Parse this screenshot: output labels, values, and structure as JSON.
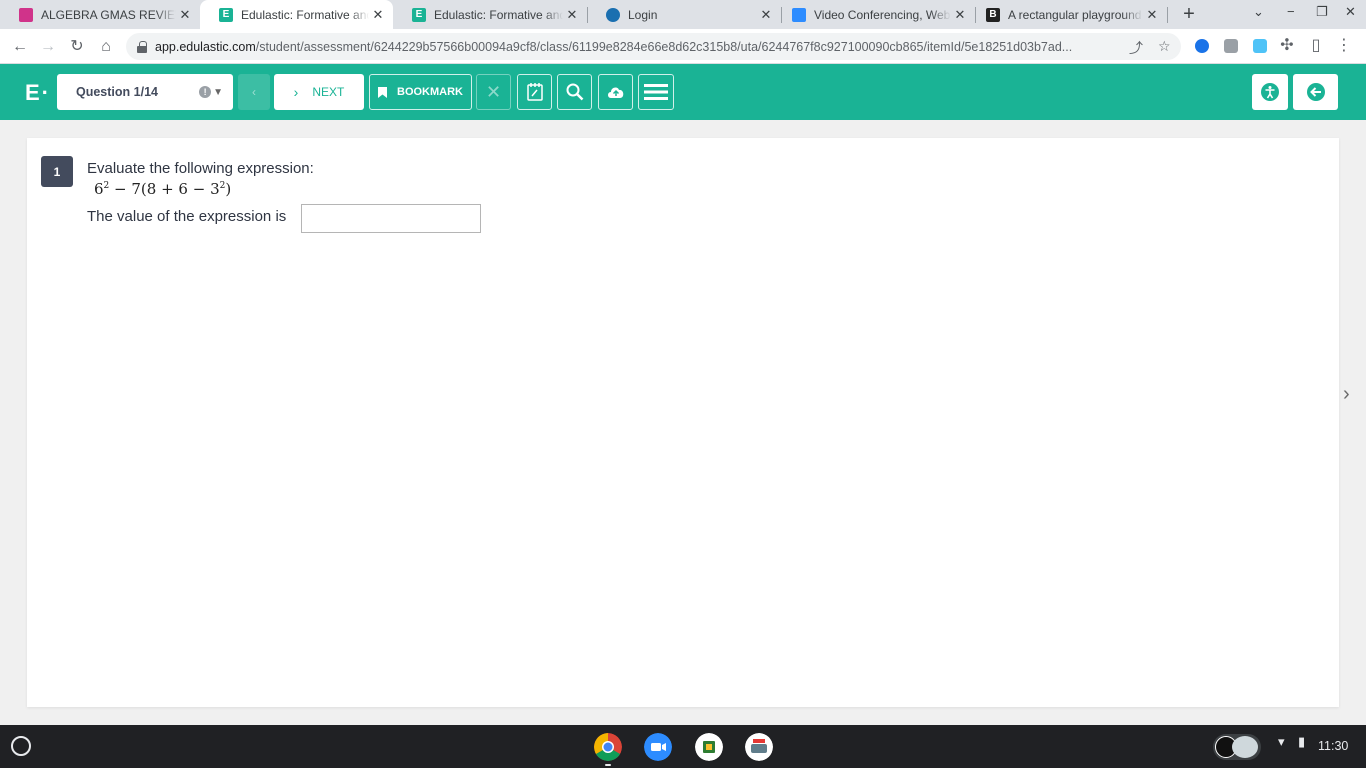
{
  "browser": {
    "tabs": [
      {
        "title": "ALGEBRA GMAS REVIEW",
        "favicon_color": "#d0338a",
        "favicon_glyph": "",
        "active": false
      },
      {
        "title": "Edulastic: Formative and Summative Assessments",
        "favicon_color": "#1ab395",
        "favicon_glyph": "E",
        "active": true
      },
      {
        "title": "Edulastic: Formative and Summative Assessments",
        "favicon_color": "#1ab395",
        "favicon_glyph": "E",
        "active": false
      },
      {
        "title": "Login",
        "favicon_color": "#1a6fb0",
        "favicon_glyph": "",
        "active": false
      },
      {
        "title": "Video Conferencing, Web Conferencing",
        "favicon_color": "#2d8cff",
        "favicon_glyph": "",
        "active": false
      },
      {
        "title": "A rectangular playground measures",
        "favicon_color": "#222222",
        "favicon_glyph": "B",
        "active": false
      }
    ],
    "tab_close_glyph": "✕",
    "new_tab_glyph": "+",
    "url_host": "app.edulastic.com",
    "url_path": "/student/assessment/6244229b57566b00094a9cf8/class/61199e8284e66e8d62c315b8/uta/6244767f8c927100090cb865/itemId/5e18251d03b7ad..."
  },
  "header": {
    "logo": "E·",
    "question_selector": "Question 1/14",
    "next_label": "NEXT",
    "bookmark_label": "BOOKMARK",
    "accent_color": "#1ab395"
  },
  "question": {
    "number": "1",
    "prompt": "Evaluate the following expression:",
    "expression": {
      "base1": "6",
      "exp1": "2",
      "middle": " − 7(8 + 6 − ",
      "base2": "3",
      "exp2": "2",
      "end": ")"
    },
    "answer_label": "The value of the expression is",
    "answer_value": ""
  },
  "shelf": {
    "time": "11:30"
  }
}
